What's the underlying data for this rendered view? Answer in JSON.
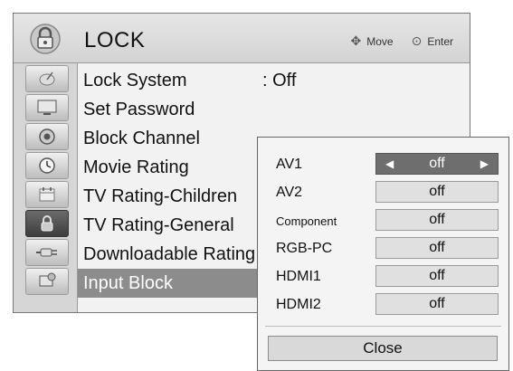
{
  "header": {
    "title": "LOCK",
    "move_hint": "Move",
    "enter_hint": "Enter",
    "icon": "lock-icon"
  },
  "sidebar_icons": [
    {
      "name": "satellite-dish-icon"
    },
    {
      "name": "monitor-icon"
    },
    {
      "name": "speaker-icon"
    },
    {
      "name": "clock-icon"
    },
    {
      "name": "calendar-icon"
    },
    {
      "name": "lock-icon",
      "active": true
    },
    {
      "name": "plug-icon"
    },
    {
      "name": "screen-settings-icon"
    }
  ],
  "menu": {
    "items": [
      {
        "label": "Lock System",
        "value": ": Off"
      },
      {
        "label": "Set Password",
        "value": ""
      },
      {
        "label": "Block Channel",
        "value": ""
      },
      {
        "label": "Movie Rating",
        "value": ""
      },
      {
        "label": "TV Rating-Children",
        "value": ""
      },
      {
        "label": "TV Rating-General",
        "value": ""
      },
      {
        "label": "Downloadable Rating",
        "value": ""
      },
      {
        "label": "Input Block",
        "value": "",
        "active": true
      }
    ]
  },
  "input_block": {
    "rows": [
      {
        "label": "AV1",
        "value": "off",
        "selected": true
      },
      {
        "label": "AV2",
        "value": "off"
      },
      {
        "label": "Component",
        "value": "off"
      },
      {
        "label": "RGB-PC",
        "value": "off"
      },
      {
        "label": "HDMI1",
        "value": "off"
      },
      {
        "label": "HDMI2",
        "value": "off"
      }
    ],
    "close_label": "Close"
  },
  "colors": {
    "highlight": "#8c8c8c",
    "selected_value": "#6e6e6e",
    "panel": "#f2f2f2"
  }
}
